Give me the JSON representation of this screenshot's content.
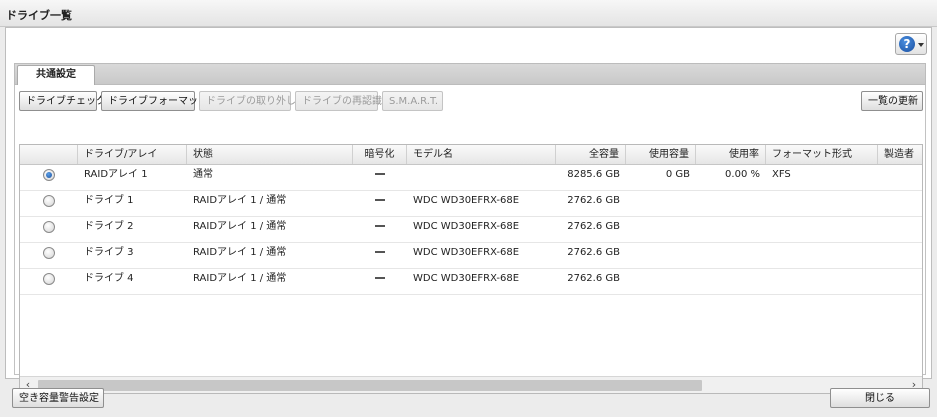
{
  "window": {
    "title": "ドライブ一覧"
  },
  "help": {
    "glyph": "?"
  },
  "tabs": [
    {
      "label": "共通設定"
    }
  ],
  "toolbar": {
    "drive_check": "ドライブチェック",
    "drive_format": "ドライブフォーマット",
    "drive_remove": "ドライブの取り外し",
    "drive_rescan": "ドライブの再認識",
    "smart": "S.M.A.R.T.",
    "refresh": "一覧の更新"
  },
  "table": {
    "columns": {
      "drive": "ドライブ/アレイ",
      "status": "状態",
      "encryption": "暗号化",
      "model": "モデル名",
      "capacity": "全容量",
      "used": "使用容量",
      "usage": "使用率",
      "format": "フォーマット形式",
      "maker": "製造者"
    },
    "rows": [
      {
        "selected": true,
        "drive": "RAIDアレイ 1",
        "status": "通常",
        "model": "",
        "capacity": "8285.6 GB",
        "used": "0 GB",
        "usage": "0.00 %",
        "format": "XFS"
      },
      {
        "selected": false,
        "drive": "ドライブ 1",
        "status": "RAIDアレイ 1 / 通常",
        "model": "WDC WD30EFRX-68E",
        "capacity": "2762.6 GB",
        "used": "",
        "usage": "",
        "format": ""
      },
      {
        "selected": false,
        "drive": "ドライブ 2",
        "status": "RAIDアレイ 1 / 通常",
        "model": "WDC WD30EFRX-68E",
        "capacity": "2762.6 GB",
        "used": "",
        "usage": "",
        "format": ""
      },
      {
        "selected": false,
        "drive": "ドライブ 3",
        "status": "RAIDアレイ 1 / 通常",
        "model": "WDC WD30EFRX-68E",
        "capacity": "2762.6 GB",
        "used": "",
        "usage": "",
        "format": ""
      },
      {
        "selected": false,
        "drive": "ドライブ 4",
        "status": "RAIDアレイ 1 / 通常",
        "model": "WDC WD30EFRX-68E",
        "capacity": "2762.6 GB",
        "used": "",
        "usage": "",
        "format": ""
      }
    ]
  },
  "footer": {
    "space_warning": "空き容量警告設定",
    "close": "閉じる"
  }
}
